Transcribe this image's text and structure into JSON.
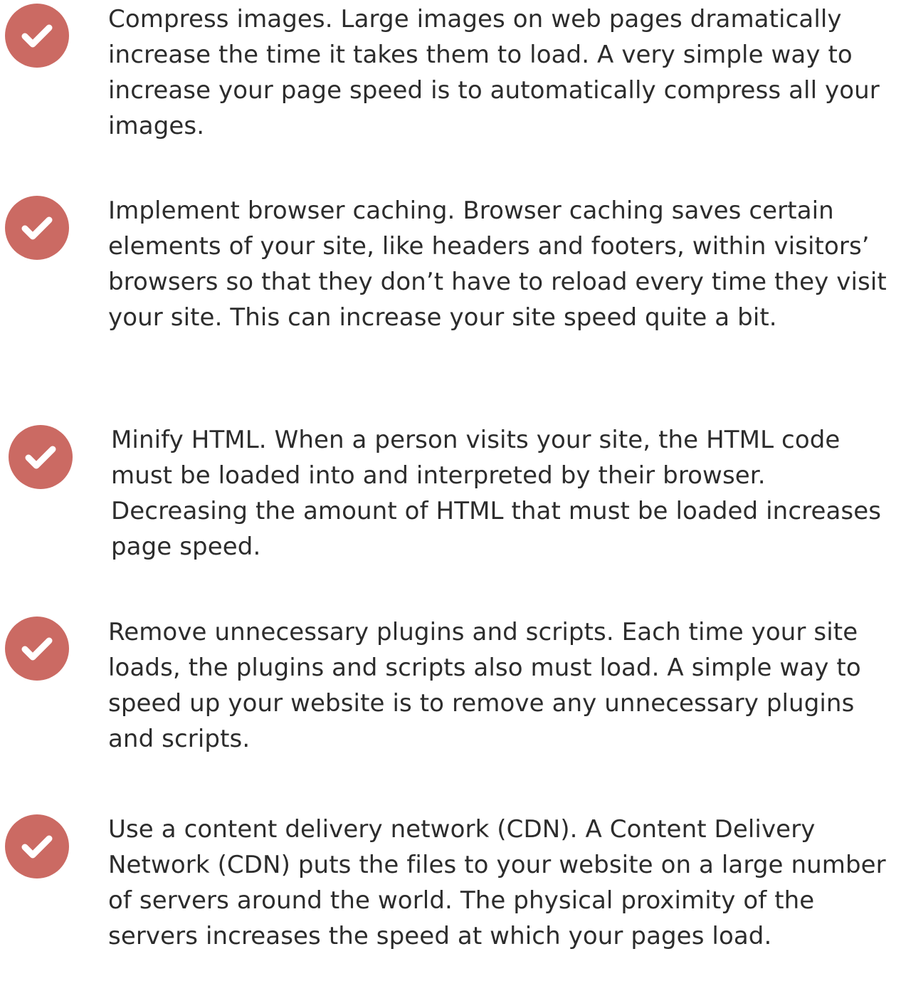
{
  "accent_color": "#cb6a63",
  "items": [
    {
      "icon": "check-circle-icon",
      "text": "Compress images. Large images on web pages dramatically increase the time it takes them to load. A very simple way to increase your page speed is to automatically compress all your images."
    },
    {
      "icon": "check-circle-icon",
      "text": "Implement browser caching. Browser caching saves certain elements of your site, like headers and footers, within visitors’ browsers so that they don’t have to reload every time they visit your site. This can increase your site speed quite a bit."
    },
    {
      "icon": "check-circle-icon",
      "text": "Minify HTML. When a person visits your site, the HTML code must be loaded into and interpreted by their browser. Decreasing the amount of HTML that must be loaded increases page speed."
    },
    {
      "icon": "check-circle-icon",
      "text": "Remove unnecessary plugins and scripts. Each time your site loads, the plugins and scripts also must load. A simple way to speed up your website is to remove any unnecessary plugins and scripts."
    },
    {
      "icon": "check-circle-icon",
      "text": "Use a content delivery network (CDN). A Content Delivery Network (CDN) puts the files to your website on a large number of servers around the world. The physical proximity of the servers increases the speed at which your pages load."
    }
  ]
}
